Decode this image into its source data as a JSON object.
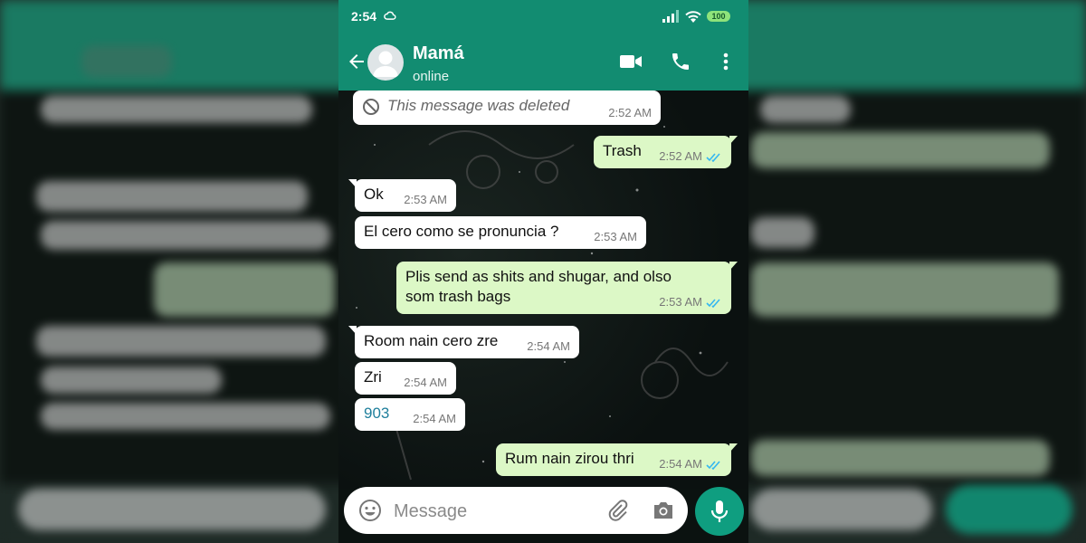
{
  "status": {
    "time": "2:54",
    "battery": "100"
  },
  "header": {
    "contact_name": "Mamá",
    "presence": "online"
  },
  "messages": [
    {
      "dir": "in",
      "text": "This message was deleted",
      "time": "2:52 AM",
      "deleted": true
    },
    {
      "dir": "out",
      "text": "Trash",
      "time": "2:52 AM",
      "read": true
    },
    {
      "dir": "in",
      "text": "Ok",
      "time": "2:53 AM"
    },
    {
      "dir": "in",
      "text": "El cero como se pronuncia ?",
      "time": "2:53 AM"
    },
    {
      "dir": "out",
      "text_line1": "Plis send as shits and shugar, and olso",
      "text_line2": "som trash bags",
      "time": "2:53 AM",
      "read": true
    },
    {
      "dir": "in",
      "text": "Room nain cero zre",
      "time": "2:54 AM"
    },
    {
      "dir": "in",
      "text": "Zri",
      "time": "2:54 AM"
    },
    {
      "dir": "in",
      "text": "903",
      "time": "2:54 AM",
      "is_link": true
    },
    {
      "dir": "out",
      "text": "Rum nain zirou thri",
      "time": "2:54 AM",
      "read": true
    }
  ],
  "composer": {
    "placeholder": "Message"
  },
  "colors": {
    "header": "#128c71",
    "outgoing_bubble": "#dcf8c6",
    "incoming_bubble": "#ffffff",
    "mic_button": "#0f9e80",
    "read_ticks": "#34b7f1"
  },
  "icons": [
    "back-arrow-icon",
    "video-call-icon",
    "phone-icon",
    "more-vert-icon",
    "deleted-icon",
    "double-check-icon",
    "emoji-icon",
    "attach-icon",
    "camera-icon",
    "mic-icon"
  ]
}
